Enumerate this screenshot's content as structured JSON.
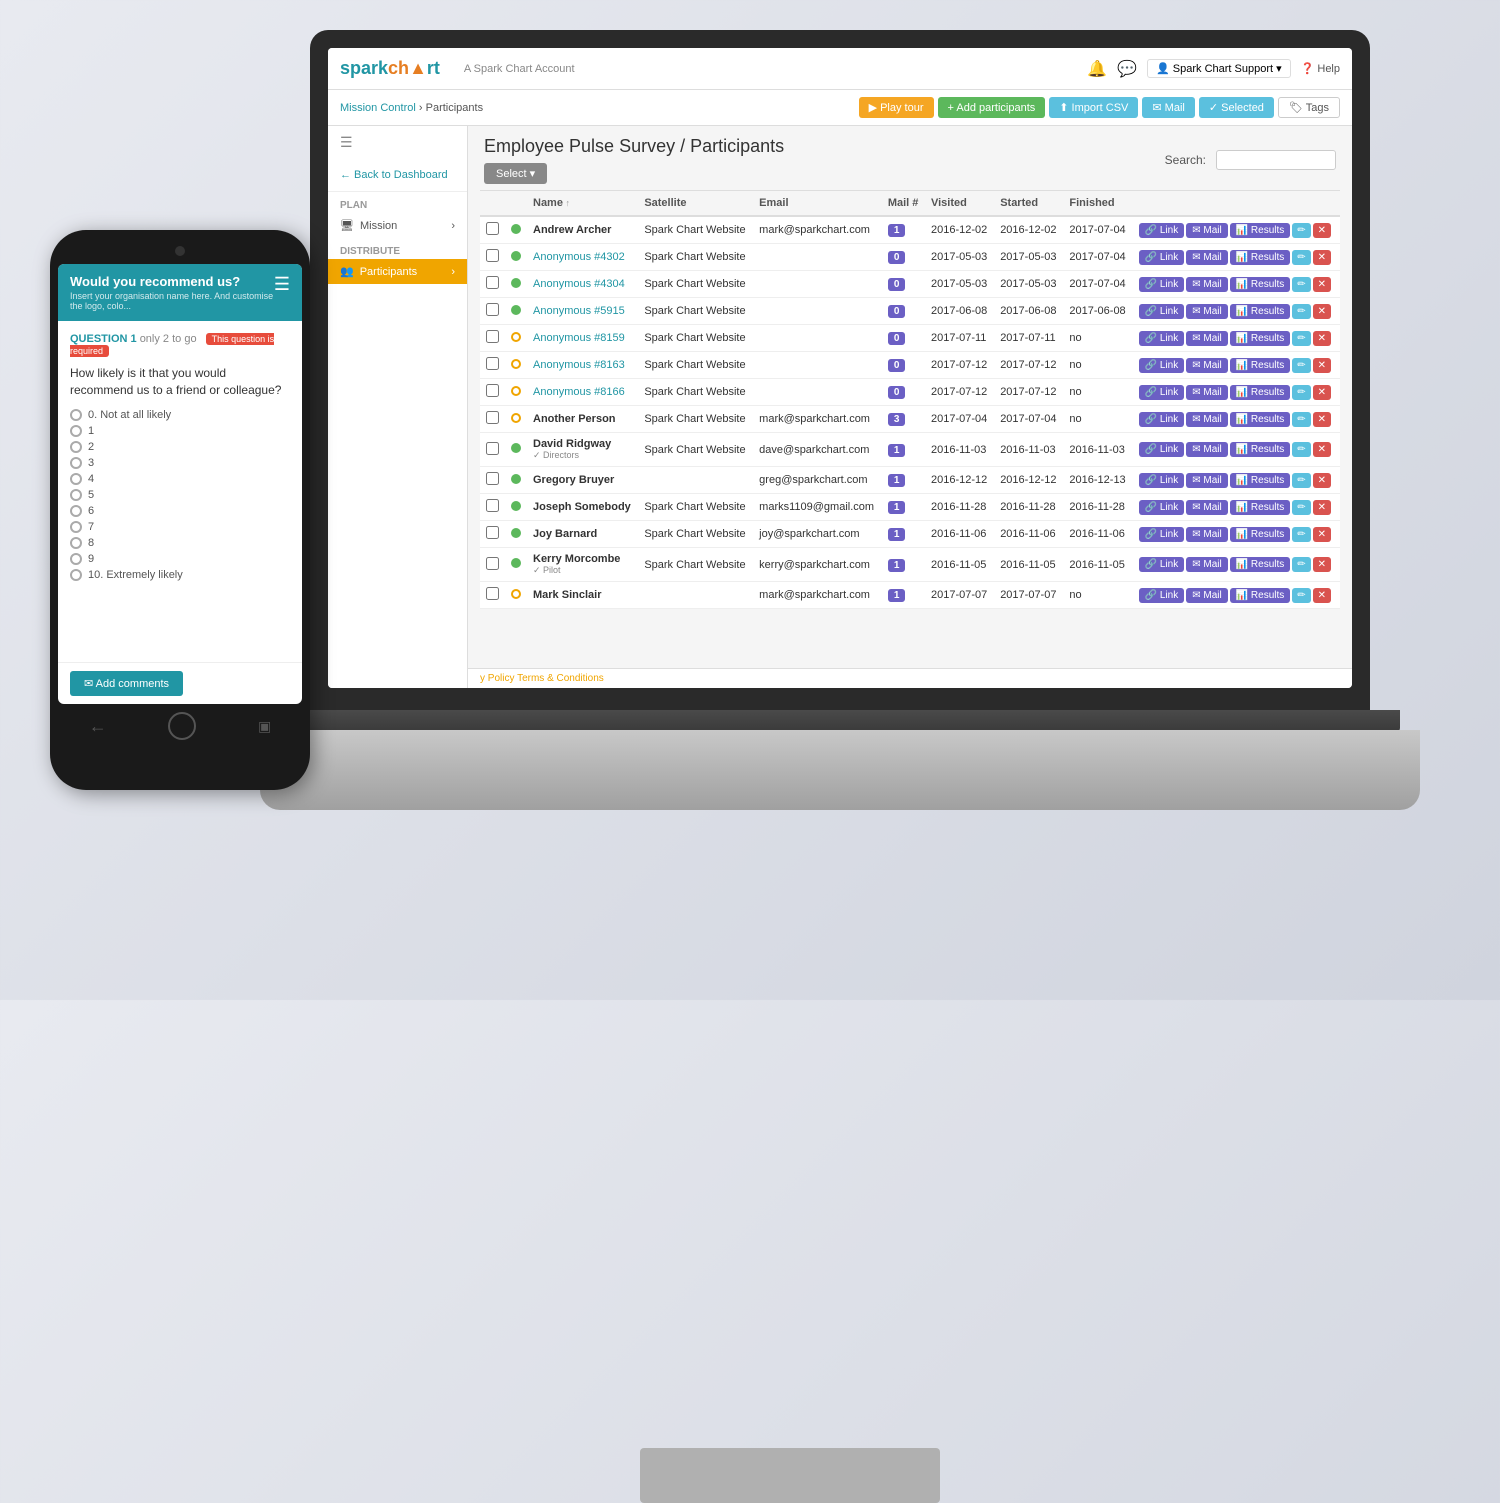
{
  "app": {
    "logo": "sparkchart",
    "account": "A Spark Chart Account",
    "back_label": "Back to Dashboard",
    "support_label": "Spark Chart Support",
    "help_label": "Help"
  },
  "subnav": {
    "breadcrumb1": "Mission Control",
    "breadcrumb2": "Participants",
    "btn_tour": "▶ Play tour",
    "btn_add": "+ Add participants",
    "btn_import": "⬆ Import CSV",
    "btn_mail": "✉ Mail",
    "btn_selected": "✓ Selected",
    "btn_tags": "🏷 Tags"
  },
  "sidebar": {
    "back": "← Back to Dashboard",
    "plan_label": "PLAN",
    "mission_label": "Mission",
    "distribute_label": "DISTRIBUTE",
    "participants_label": "Participants"
  },
  "page": {
    "title": "Employee Pulse Survey / Participants",
    "select_label": "Select ▾",
    "search_label": "Search:"
  },
  "table": {
    "headers": [
      "",
      "",
      "Name",
      "Satellite",
      "Email",
      "Mail #",
      "Visited",
      "Started",
      "Finished",
      ""
    ],
    "rows": [
      {
        "status": "green",
        "name": "Andrew Archer",
        "bold": true,
        "satellite": "Spark Chart Website",
        "email": "mark@sparkchart.com",
        "mail": "1",
        "visited": "2016-12-02",
        "started": "2016-12-02",
        "finished": "2017-07-04"
      },
      {
        "status": "green",
        "name": "Anonymous #4302",
        "bold": false,
        "satellite": "Spark Chart Website",
        "email": "",
        "mail": "0",
        "visited": "2017-05-03",
        "started": "2017-05-03",
        "finished": "2017-07-04"
      },
      {
        "status": "green",
        "name": "Anonymous #4304",
        "bold": false,
        "satellite": "Spark Chart Website",
        "email": "",
        "mail": "0",
        "visited": "2017-05-03",
        "started": "2017-05-03",
        "finished": "2017-07-04"
      },
      {
        "status": "green",
        "name": "Anonymous #5915",
        "bold": false,
        "satellite": "Spark Chart Website",
        "email": "",
        "mail": "0",
        "visited": "2017-06-08",
        "started": "2017-06-08",
        "finished": "2017-06-08"
      },
      {
        "status": "orange",
        "name": "Anonymous #8159",
        "bold": false,
        "satellite": "Spark Chart Website",
        "email": "",
        "mail": "0",
        "visited": "2017-07-11",
        "started": "2017-07-11",
        "finished": "no"
      },
      {
        "status": "orange",
        "name": "Anonymous #8163",
        "bold": false,
        "satellite": "Spark Chart Website",
        "email": "",
        "mail": "0",
        "visited": "2017-07-12",
        "started": "2017-07-12",
        "finished": "no"
      },
      {
        "status": "orange",
        "name": "Anonymous #8166",
        "bold": false,
        "satellite": "Spark Chart Website",
        "email": "",
        "mail": "0",
        "visited": "2017-07-12",
        "started": "2017-07-12",
        "finished": "no"
      },
      {
        "status": "orange",
        "name": "Another Person",
        "bold": true,
        "satellite": "Spark Chart Website",
        "email": "mark@sparkchart.com",
        "mail": "3",
        "visited": "2017-07-04",
        "started": "2017-07-04",
        "finished": "no"
      },
      {
        "status": "green",
        "name": "David Ridgway",
        "tag": "Directors",
        "bold": true,
        "satellite": "Spark Chart Website",
        "email": "dave@sparkchart.com",
        "mail": "1",
        "visited": "2016-11-03",
        "started": "2016-11-03",
        "finished": "2016-11-03"
      },
      {
        "status": "green",
        "name": "Gregory Bruyer",
        "bold": true,
        "satellite": "",
        "email": "greg@sparkchart.com",
        "mail": "1",
        "visited": "2016-12-12",
        "started": "2016-12-12",
        "finished": "2016-12-13"
      },
      {
        "status": "green",
        "name": "Joseph Somebody",
        "bold": true,
        "satellite": "Spark Chart Website",
        "email": "marks1109@gmail.com",
        "mail": "1",
        "visited": "2016-11-28",
        "started": "2016-11-28",
        "finished": "2016-11-28"
      },
      {
        "status": "green",
        "name": "Joy Barnard",
        "bold": true,
        "satellite": "Spark Chart Website",
        "email": "joy@sparkchart.com",
        "mail": "1",
        "visited": "2016-11-06",
        "started": "2016-11-06",
        "finished": "2016-11-06"
      },
      {
        "status": "green",
        "name": "Kerry Morcombe",
        "tag": "Pilot",
        "bold": true,
        "satellite": "Spark Chart Website",
        "email": "kerry@sparkchart.com",
        "mail": "1",
        "visited": "2016-11-05",
        "started": "2016-11-05",
        "finished": "2016-11-05"
      },
      {
        "status": "orange",
        "name": "Mark Sinclair",
        "bold": true,
        "satellite": "",
        "email": "mark@sparkchart.com",
        "mail": "1",
        "visited": "2017-07-07",
        "started": "2017-07-07",
        "finished": "no"
      }
    ]
  },
  "footer": {
    "policy": "y Policy",
    "terms": "Terms & Conditions"
  },
  "phone": {
    "survey_title": "Would you recommend us?",
    "survey_subtitle": "Insert your organisation name here. And customise the logo, colo...",
    "question_label": "QUESTION 1",
    "question_count": "only 2 to go",
    "question_required": "This question is required",
    "question_text": "How likely is it that you would recommend us to a friend or colleague?",
    "options": [
      "0. Not at all likely",
      "1",
      "2",
      "3",
      "4",
      "5",
      "6",
      "7",
      "8",
      "9",
      "10. Extremely likely"
    ],
    "add_comments": "✉ Add comments"
  }
}
